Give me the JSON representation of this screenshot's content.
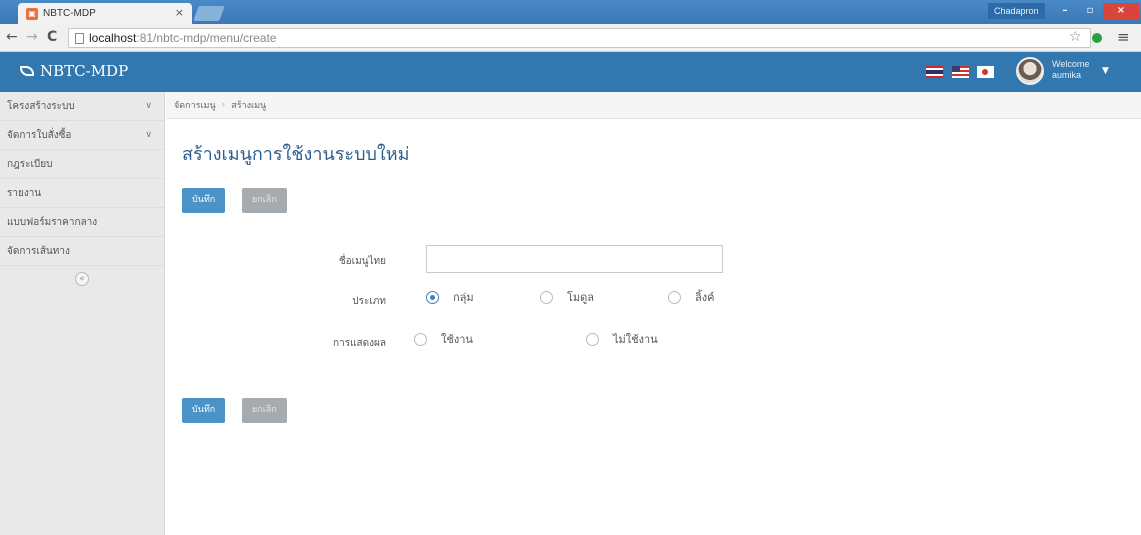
{
  "browser": {
    "tab_title": "NBTC-MDP",
    "tab_close": "×",
    "profile_name": "Chadapron",
    "url_host": "localhost",
    "url_path": ":81/nbtc-mdp/menu/create",
    "win_min": "–",
    "win_max": "▫",
    "win_close": "×"
  },
  "header": {
    "brand": "NBTC-MDP",
    "welcome_line1": "Welcome",
    "welcome_line2": "aumika",
    "languages": [
      "th-flag",
      "us-flag",
      "jp-flag"
    ]
  },
  "sidebar": {
    "items": [
      {
        "label": "โครงสร้างระบบ",
        "chevron": "∨"
      },
      {
        "label": "จัดการใบสั่งซื้อ",
        "chevron": "∨"
      },
      {
        "label": "กฎระเบียบ",
        "chevron": ""
      },
      {
        "label": "รายงาน",
        "chevron": ""
      },
      {
        "label": "แบบฟอร์มราคากลาง",
        "chevron": ""
      },
      {
        "label": "จัดการเส้นทาง",
        "chevron": ""
      }
    ],
    "collapse_label": "«"
  },
  "breadcrumb": [
    "จัดการเมนู",
    "สร้างเมนู"
  ],
  "page": {
    "title": "สร้างเมนูการใช้งานระบบใหม่",
    "save_label": "บันทึก",
    "cancel_label": "ยกเลิก"
  },
  "form": {
    "name_label": "ชื่อเมนูไทย",
    "name_value": "",
    "type_label": "ประเภท",
    "type_options": [
      {
        "label": "กลุ่ม",
        "checked": true
      },
      {
        "label": "โมดูล",
        "checked": false
      },
      {
        "label": "ลิ้งค์",
        "checked": false
      }
    ],
    "display_label": "การแสดงผล",
    "display_options": [
      {
        "label": "ใช้งาน",
        "checked": false
      },
      {
        "label": "ไม่ใช้งาน",
        "checked": false
      }
    ]
  },
  "colors": {
    "app_header": "#3277ad",
    "title": "#2d5f8e",
    "save_button": "#4b92c8",
    "cancel_button": "#a6abaf"
  }
}
